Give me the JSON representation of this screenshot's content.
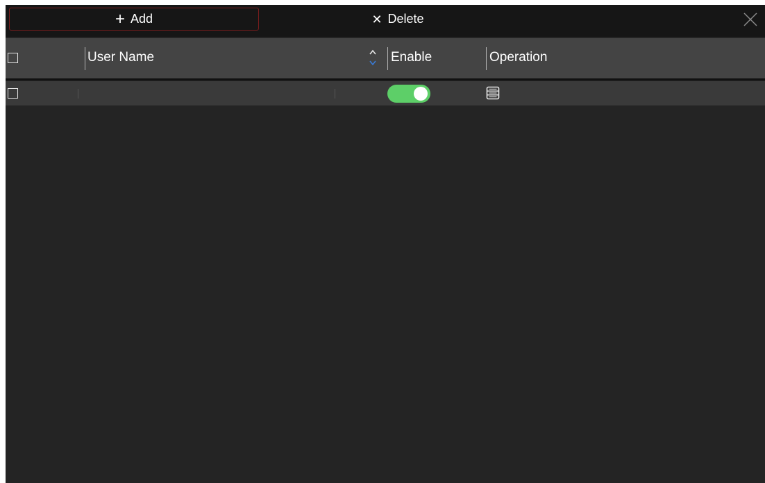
{
  "toolbar": {
    "add_label": "Add",
    "delete_label": "Delete"
  },
  "table": {
    "columns": {
      "user_name": "User Name",
      "enable": "Enable",
      "operation": "Operation"
    },
    "rows": [
      {
        "user_name": "",
        "checked": false,
        "enabled": true
      }
    ]
  },
  "icons": {
    "add": "plus-icon",
    "delete": "x-icon",
    "close": "close-icon",
    "sort": "sort-icon",
    "operation": "server-list-icon"
  },
  "colors": {
    "background": "#242424",
    "toolbar": "#161616",
    "header": "#444444",
    "row": "#3a3a3a",
    "add_border": "#7a1d1d",
    "toggle_on": "#5dcf68",
    "sort_active": "#3a7bd5"
  }
}
